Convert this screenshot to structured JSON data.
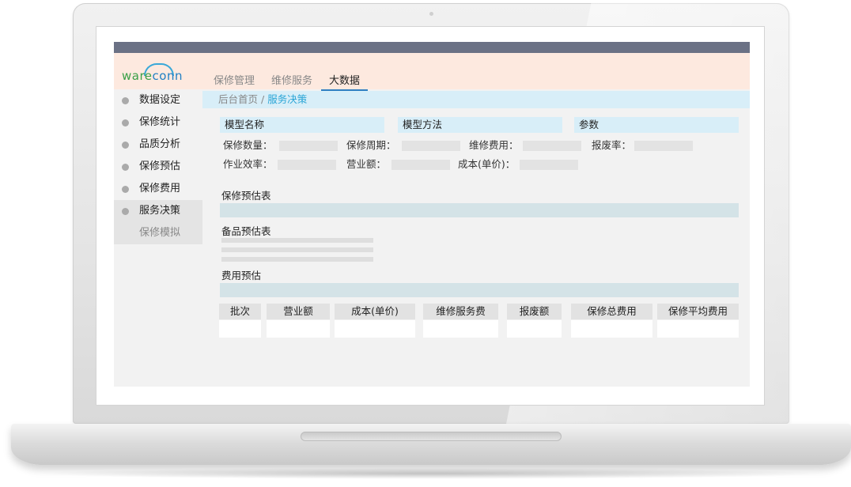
{
  "app": {
    "logo": {
      "part1": "ware",
      "part2": "conn"
    },
    "nav": [
      "保修管理",
      "维修服务",
      "大数据"
    ],
    "nav_active": 2
  },
  "sidebar": {
    "items": [
      "数据设定",
      "保修统计",
      "品质分析",
      "保修预估",
      "保修费用",
      "服务决策"
    ],
    "active_index": 5,
    "sub_item": "保修模拟"
  },
  "breadcrumb": {
    "home": "后台首页",
    "separator": "/",
    "current": "服务决策"
  },
  "model_headers": [
    "模型名称",
    "模型方法",
    "参数"
  ],
  "fields": {
    "repair_qty": "保修数量：",
    "repair_period": "保修周期：",
    "maintenance_cost": "维修费用：",
    "scrap_rate": "报废率：",
    "work_efficiency": "作业效率：",
    "revenue": "营业额：",
    "unit_cost": "成本(单价)："
  },
  "sections": {
    "repair_estimate": "保修预估表",
    "spare_estimate": "备品预估表",
    "cost_estimate": "费用预估"
  },
  "table": {
    "columns": [
      "批次",
      "营业额",
      "成本(单价)",
      "维修服务费",
      "报废额",
      "保修总费用",
      "保修平均费用"
    ]
  },
  "colors": {
    "accent": "#2aa5d6",
    "header_bg": "#fde9df",
    "top_stripe": "#6b7185",
    "breadcrumb_bg": "#d8eef8"
  }
}
